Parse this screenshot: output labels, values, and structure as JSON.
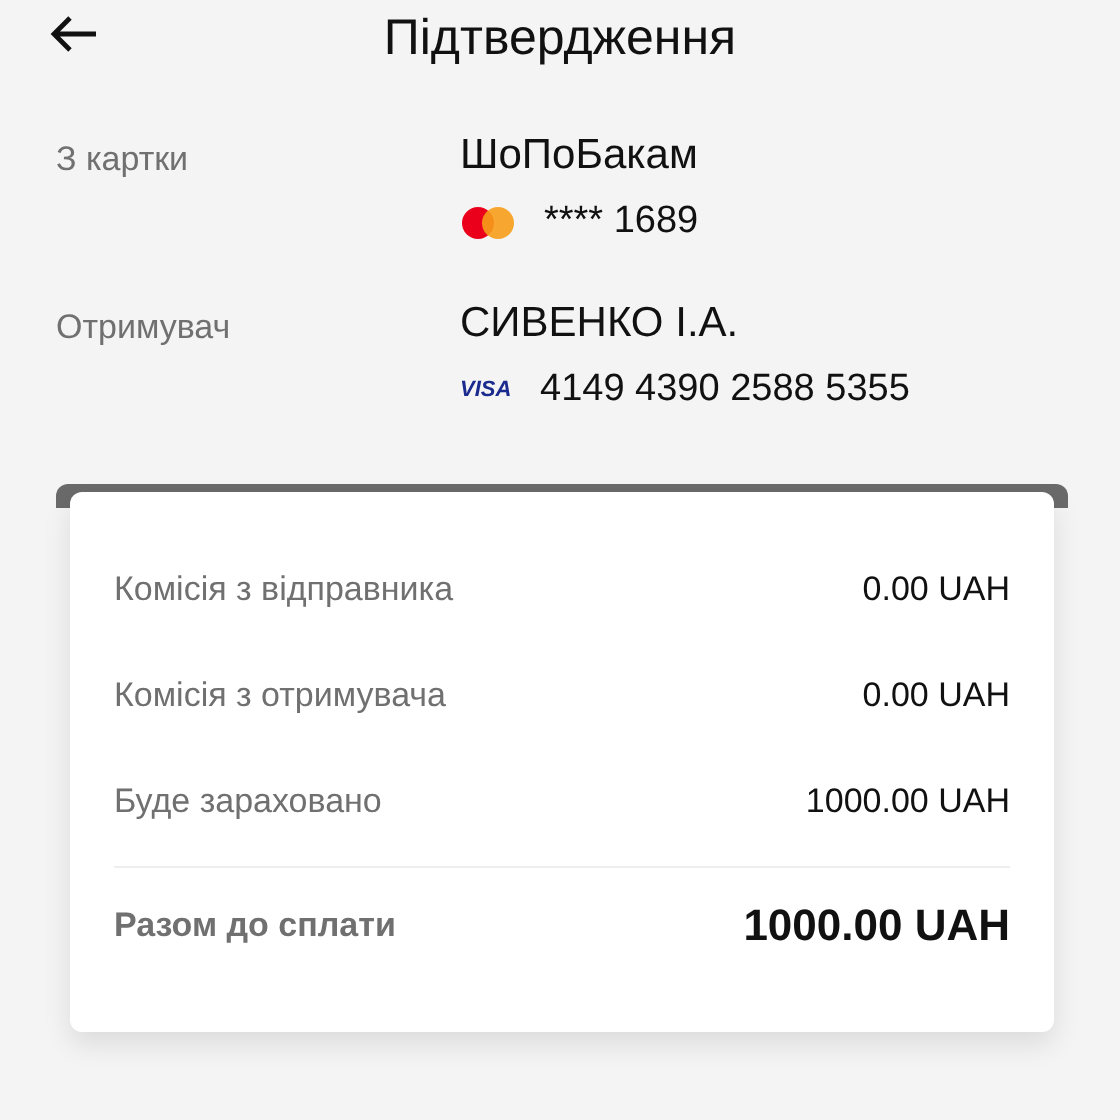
{
  "header": {
    "title": "Підтвердження"
  },
  "parties": [
    {
      "label": "З картки",
      "name": "ШоПоБакам",
      "card": {
        "kind": "mastercard",
        "number": "**** 1689"
      }
    },
    {
      "label": "Отримувач",
      "name": "СИВЕНКО І.А.",
      "card": {
        "kind": "visa",
        "logo_text": "VISA",
        "number": "4149 4390 2588 5355"
      }
    }
  ],
  "summary": [
    {
      "label": "Комісія з відправника",
      "value": "0.00 UAH",
      "kind": "line"
    },
    {
      "label": "Комісія з отримувача",
      "value": "0.00 UAH",
      "kind": "line"
    },
    {
      "label": "Буде зараховано",
      "value": "1000.00 UAH",
      "kind": "line"
    },
    {
      "label": "Разом до сплати",
      "value": "1000.00 UAH",
      "kind": "total"
    }
  ]
}
